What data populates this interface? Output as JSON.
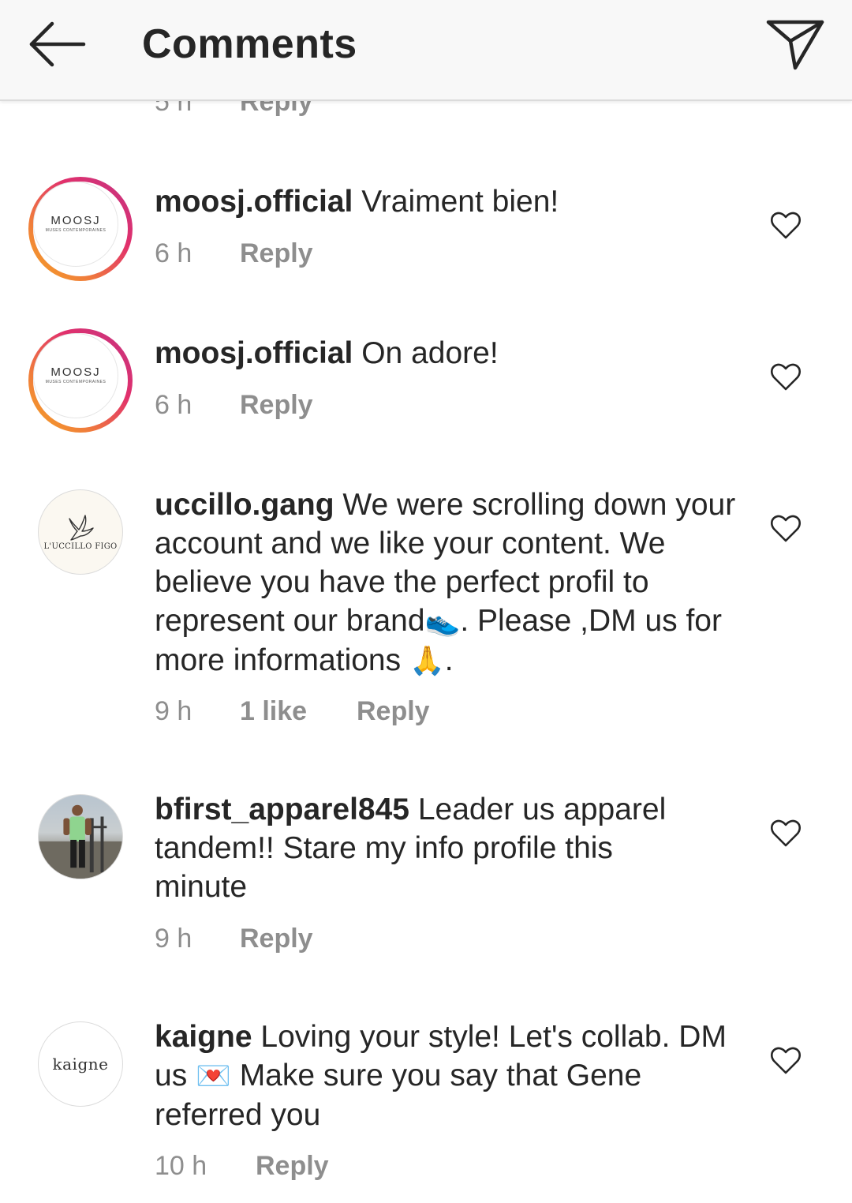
{
  "header": {
    "title": "Comments"
  },
  "partial_row": {
    "time": "5 h",
    "reply": "Reply"
  },
  "comments": [
    {
      "username": "moosj.official",
      "text": "Vraiment bien!",
      "time": "6 h",
      "likes": "",
      "reply": "Reply",
      "avatar_logo": "MOOSJ",
      "avatar_logo_sub": "MUSES CONTEMPORAINES"
    },
    {
      "username": "moosj.official",
      "text": "On adore!",
      "time": "6 h",
      "likes": "",
      "reply": "Reply",
      "avatar_logo": "MOOSJ",
      "avatar_logo_sub": "MUSES CONTEMPORAINES"
    },
    {
      "username": "uccillo.gang",
      "text_part1": "We were scrolling down your account and we like your content. We believe you have the perfect profil to represent our brand",
      "emoji1": "👟",
      "text_part2": ". Please ,DM us for more informations ",
      "emoji2": "🙏",
      "text_part3": ".",
      "time": "9 h",
      "likes": "1 like",
      "reply": "Reply",
      "avatar_logo": "L'UCCILLO FIGO"
    },
    {
      "username": "bfirst_apparel845",
      "text": "Leader us apparel tandem!! Stare my info profile this minute",
      "time": "9 h",
      "likes": "",
      "reply": "Reply"
    },
    {
      "username": "kaigne",
      "text_part1": "Loving your style! Let's collab. DM us ",
      "emoji1": "💌",
      "text_part2": " Make sure you say that Gene referred you",
      "time": "10 h",
      "likes": "",
      "reply": "Reply",
      "avatar_logo": "kaigne"
    }
  ],
  "icons": {
    "back": "arrow-left-icon",
    "share": "paper-plane-icon",
    "like": "heart-outline-icon"
  },
  "colors": {
    "text_primary": "#262626",
    "text_secondary": "#8e8e8e",
    "header_bg": "#f8f8f8",
    "story_ring_start": "#f5a623",
    "story_ring_end": "#c13584"
  }
}
